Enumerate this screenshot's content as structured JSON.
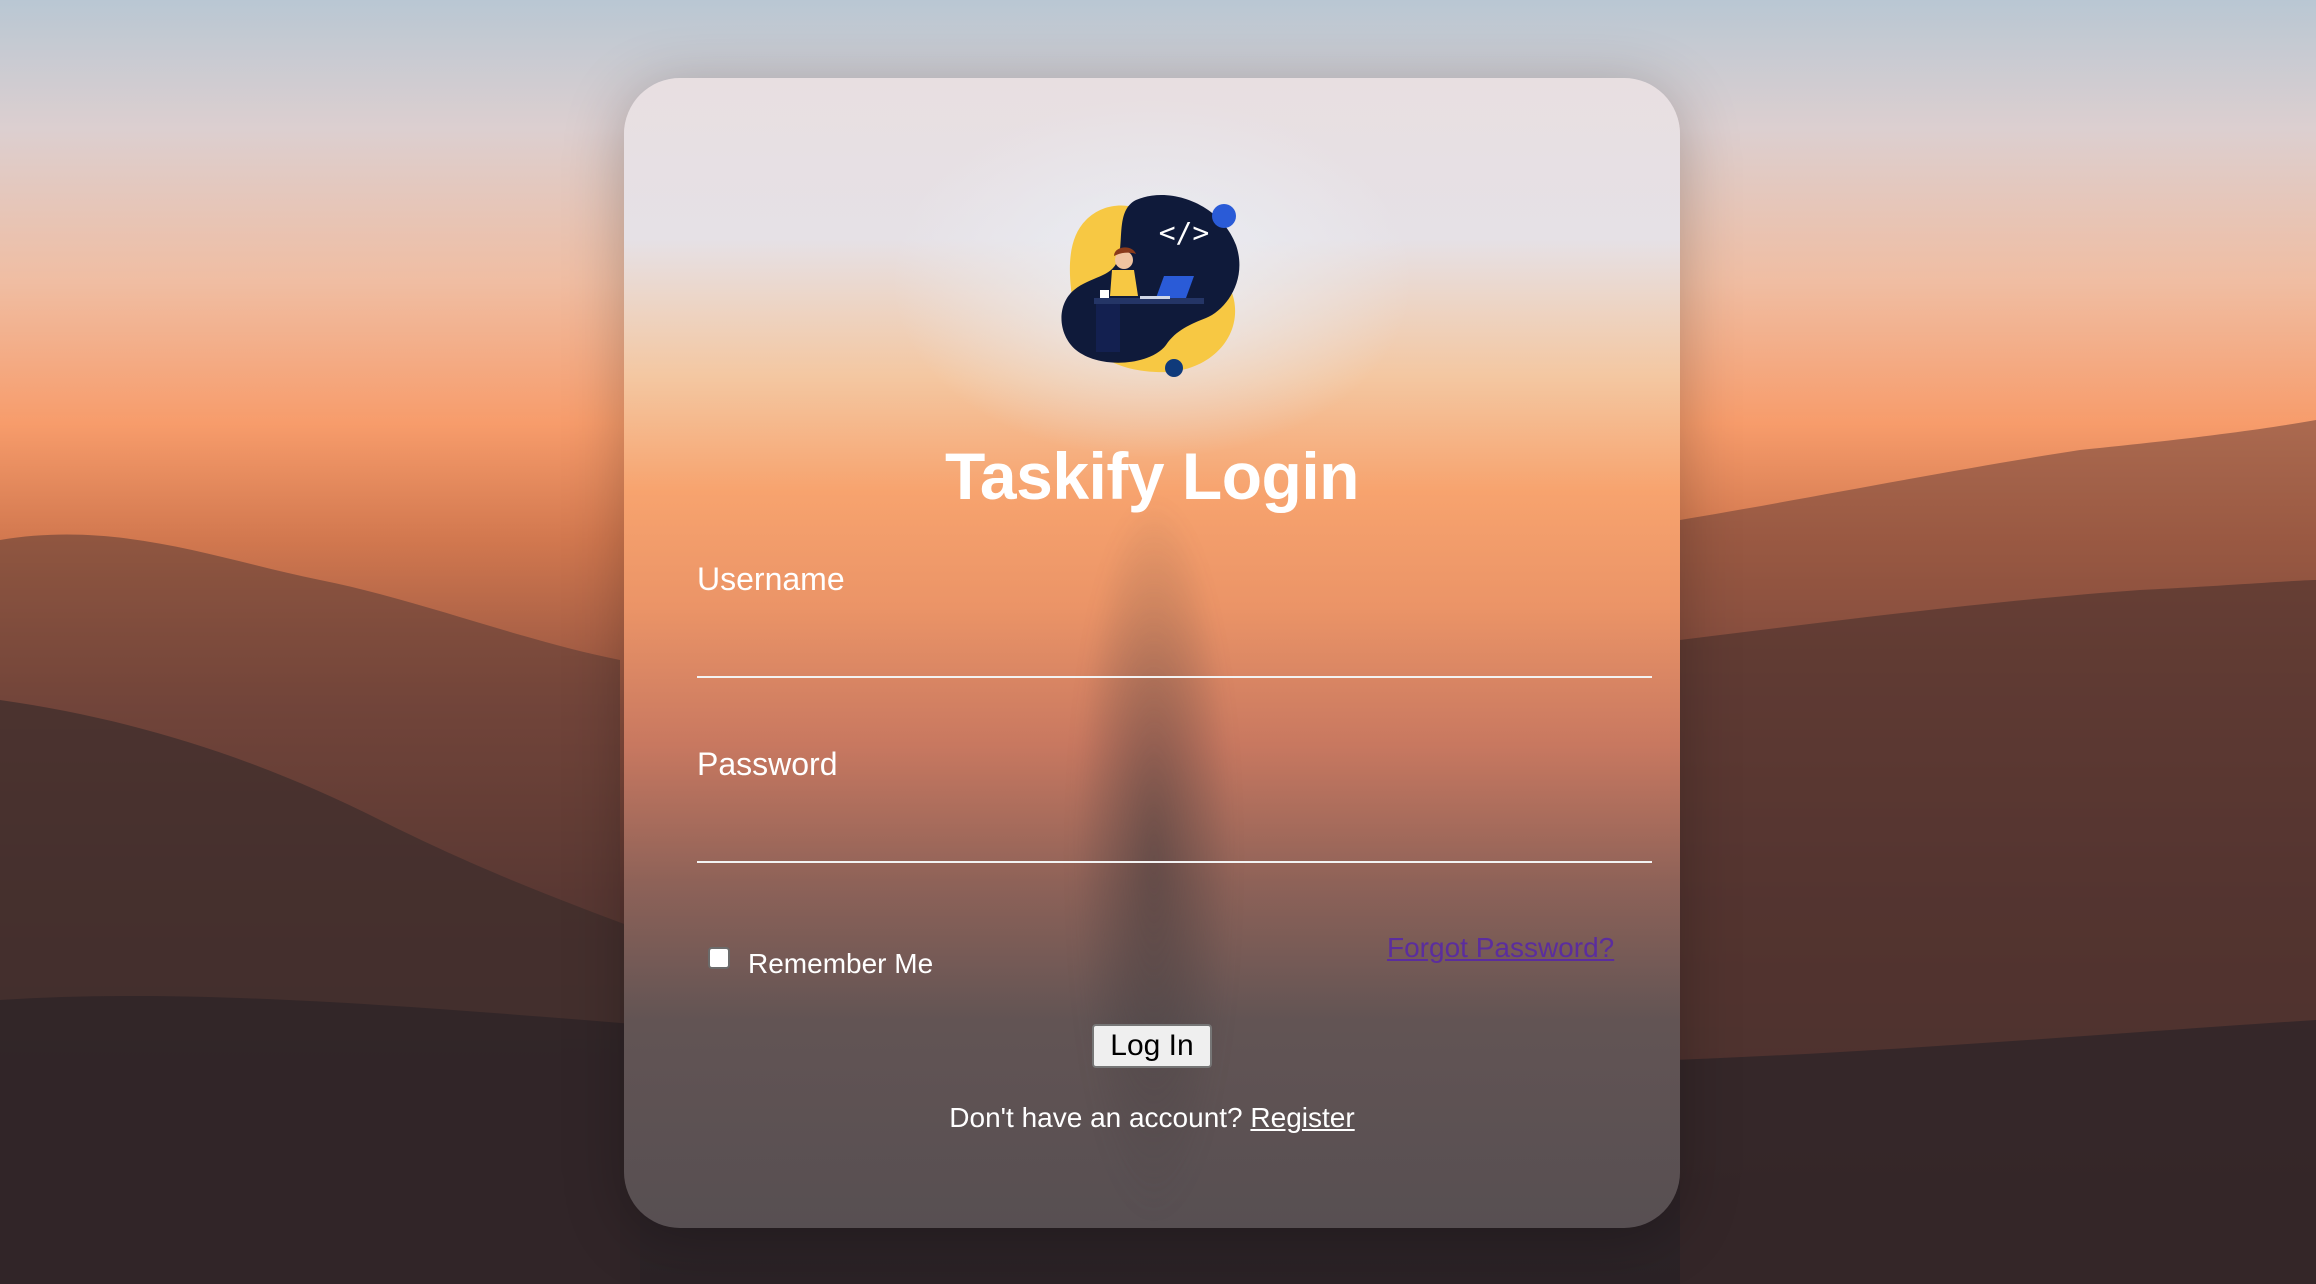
{
  "app": {
    "title": "Taskify Login"
  },
  "logo": {
    "icon": "developer-laptop-logo",
    "code_glyph": "</>"
  },
  "form": {
    "username_label": "Username",
    "username_value": "",
    "password_label": "Password",
    "password_value": "",
    "remember_label": "Remember Me",
    "remember_checked": false,
    "forgot_label": "Forgot Password?",
    "login_label": "Log In",
    "register_prompt": "Don't have an account?",
    "register_label": "Register"
  },
  "colors": {
    "link_visited": "#5b2d9e",
    "text": "#ffffff",
    "logo_navy": "#0f1a3a",
    "logo_yellow": "#f7c843",
    "logo_blue": "#2a5bd7"
  }
}
